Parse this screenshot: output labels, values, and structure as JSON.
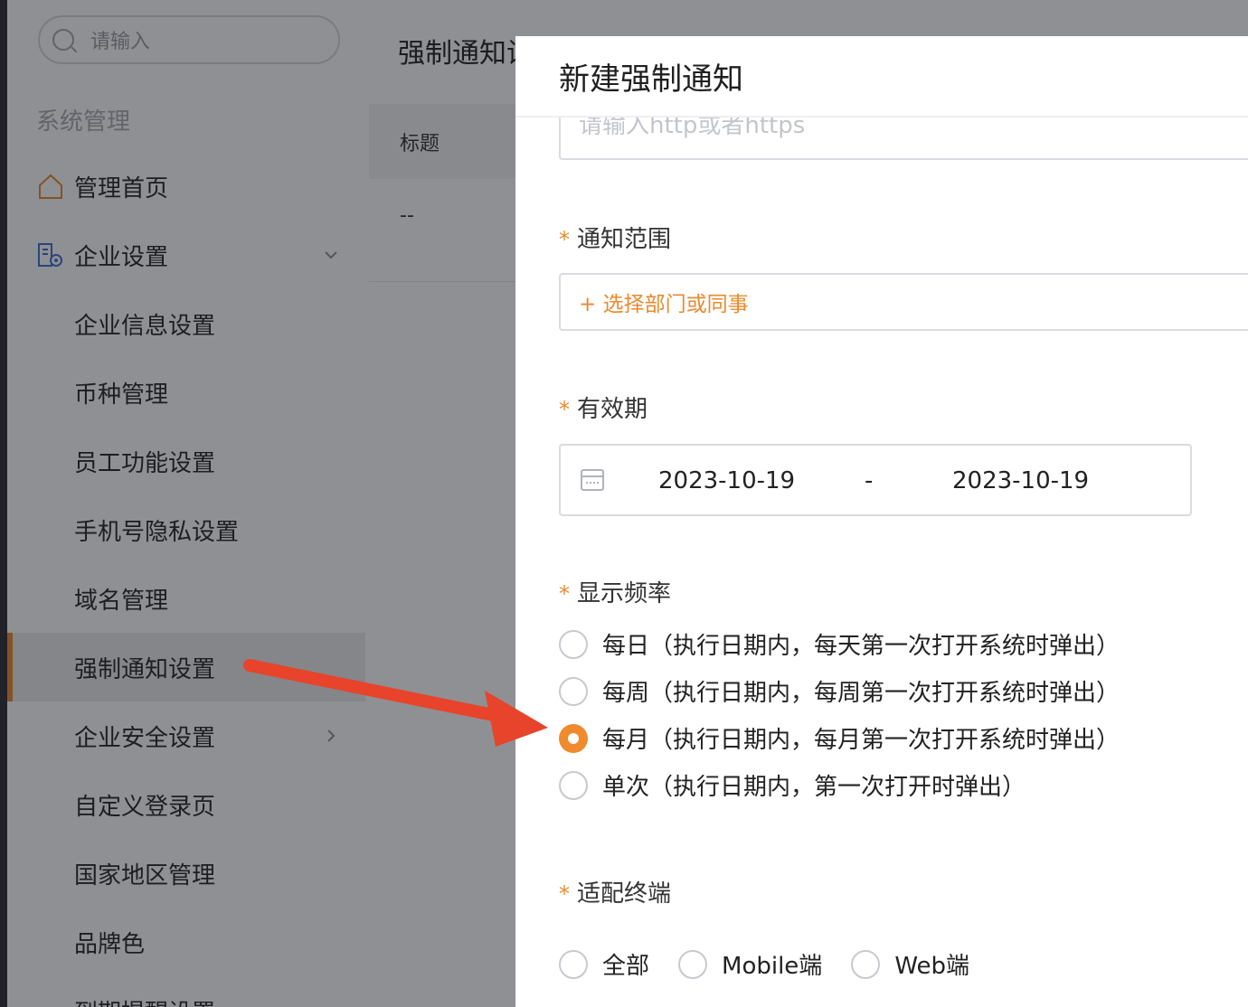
{
  "sidebar": {
    "search_placeholder": "请输入",
    "section_title": "系统管理",
    "items": [
      {
        "label": "管理首页",
        "level": "top",
        "icon": "home-icon"
      },
      {
        "label": "企业设置",
        "level": "top",
        "icon": "enterprise-settings-icon",
        "expand": "chevron-down-icon"
      },
      {
        "label": "企业信息设置",
        "level": "sub"
      },
      {
        "label": "币种管理",
        "level": "sub"
      },
      {
        "label": "员工功能设置",
        "level": "sub"
      },
      {
        "label": "手机号隐私设置",
        "level": "sub"
      },
      {
        "label": "域名管理",
        "level": "sub"
      },
      {
        "label": "强制通知设置",
        "level": "sub",
        "active": true
      },
      {
        "label": "企业安全设置",
        "level": "sub",
        "expand": "chevron-right-icon"
      },
      {
        "label": "自定义登录页",
        "level": "sub"
      },
      {
        "label": "国家地区管理",
        "level": "sub"
      },
      {
        "label": "品牌色",
        "level": "sub"
      },
      {
        "label": "到期提醒设置",
        "level": "sub"
      }
    ]
  },
  "page": {
    "title": "强制通知设置",
    "table_header": "标题",
    "table_cell": "--"
  },
  "drawer": {
    "title": "新建强制通知",
    "url_placeholder": "请输入http或者https",
    "scope": {
      "label": "通知范围",
      "required_mark": "*",
      "button": "+ 选择部门或同事"
    },
    "validity": {
      "label": "有效期",
      "required_mark": "*",
      "start": "2023-10-19",
      "separator": "-",
      "end": "2023-10-19"
    },
    "frequency": {
      "label": "显示频率",
      "required_mark": "*",
      "options": [
        {
          "label": "每日（执行日期内，每天第一次打开系统时弹出）",
          "checked": false
        },
        {
          "label": "每周（执行日期内，每周第一次打开系统时弹出）",
          "checked": false
        },
        {
          "label": "每月（执行日期内，每月第一次打开系统时弹出）",
          "checked": true
        },
        {
          "label": "单次（执行日期内，第一次打开时弹出）",
          "checked": false
        }
      ]
    },
    "terminal": {
      "label": "适配终端",
      "required_mark": "*",
      "options": [
        {
          "label": "全部",
          "checked": false
        },
        {
          "label": "Mobile端",
          "checked": false
        },
        {
          "label": "Web端",
          "checked": false
        }
      ]
    }
  },
  "colors": {
    "accent": "#ef8b2c",
    "annotation_arrow": "#e8432b"
  }
}
